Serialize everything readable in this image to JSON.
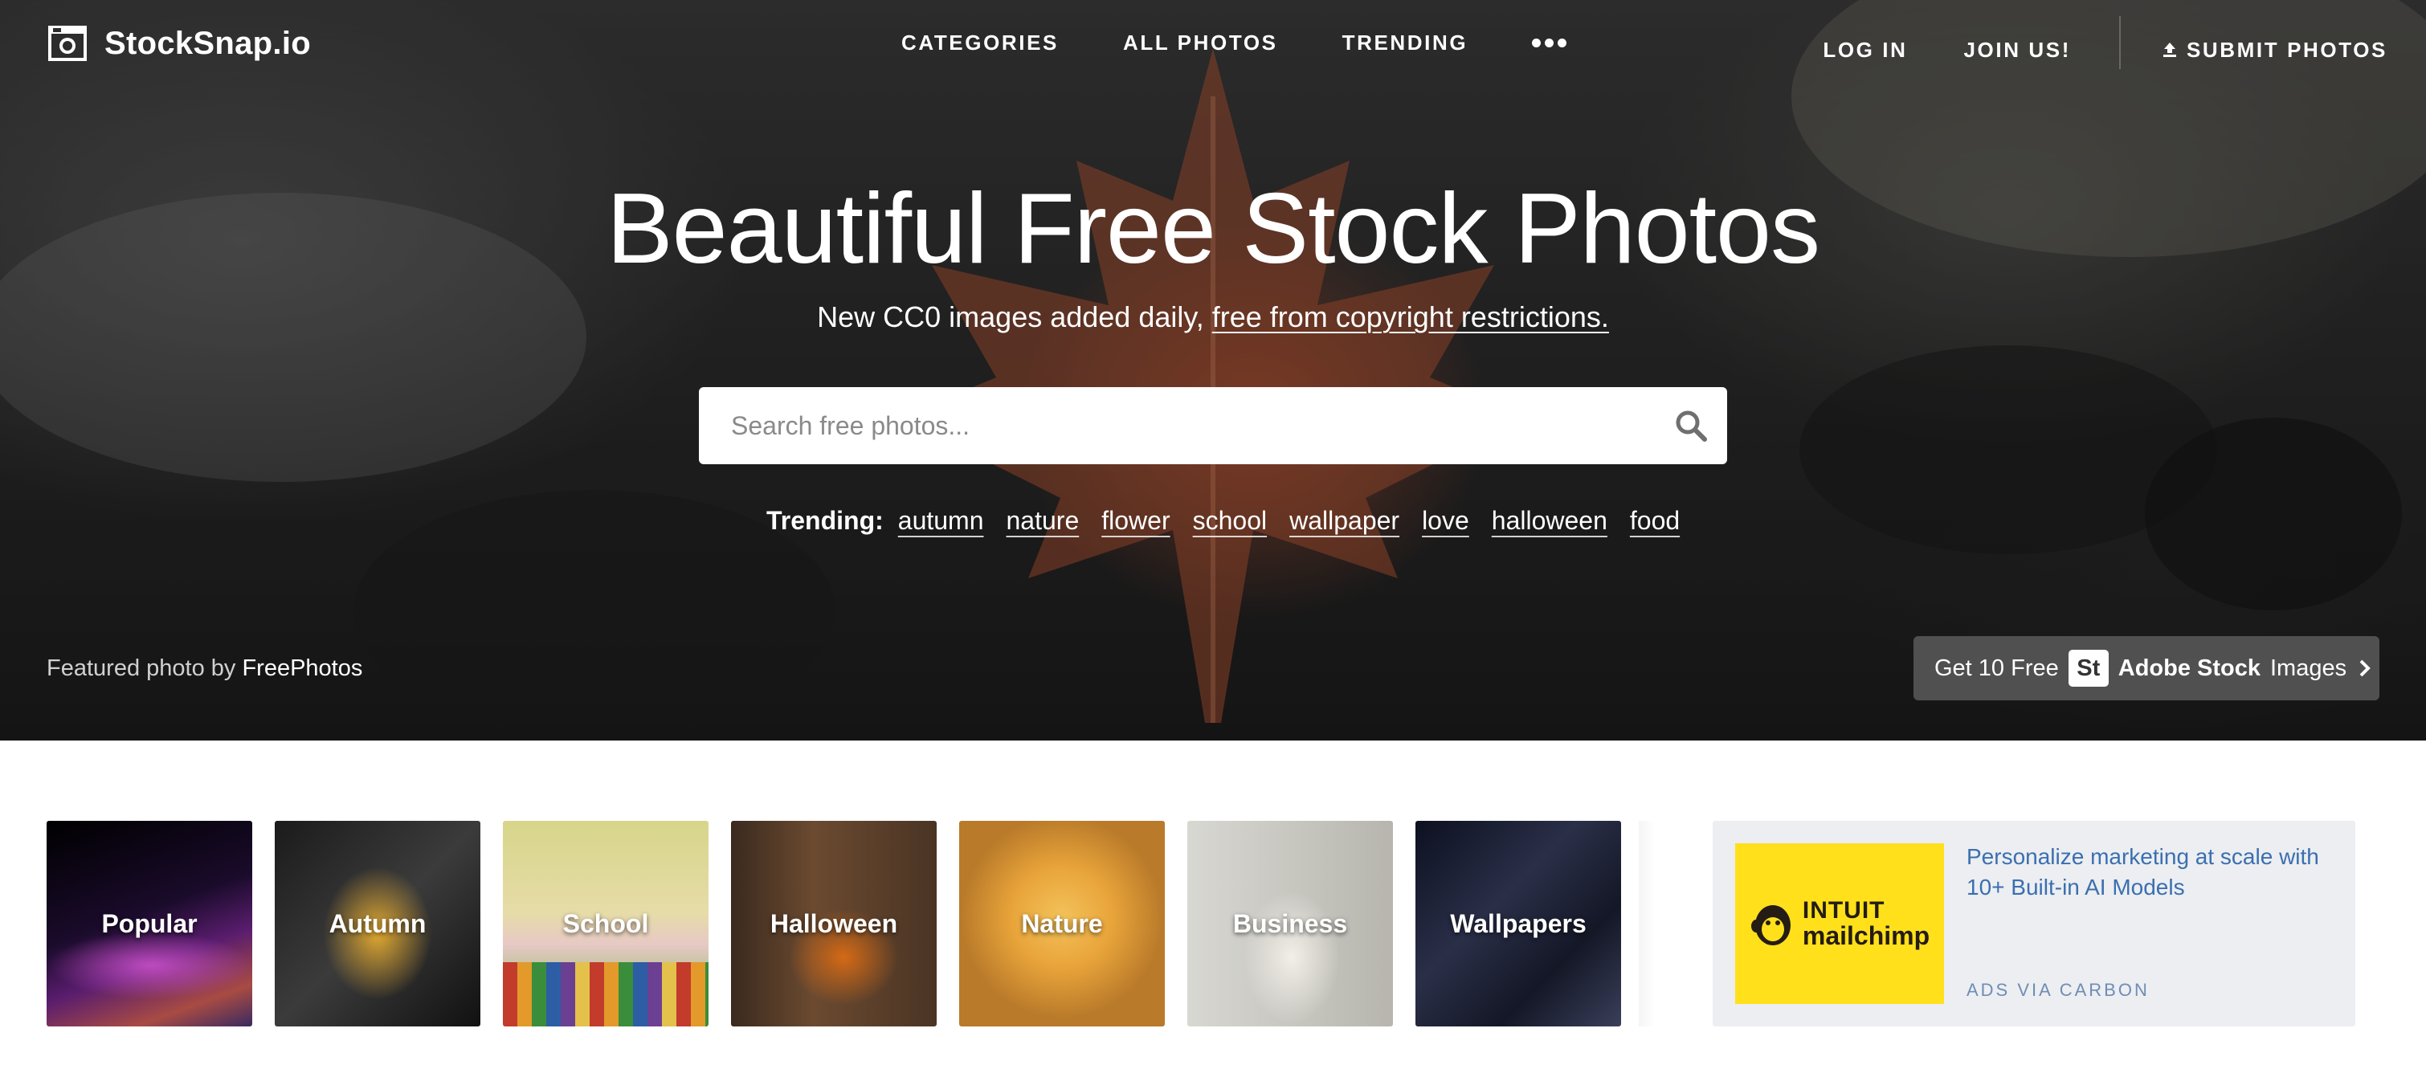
{
  "brand": {
    "name": "StockSnap.io",
    "icon": "camera-icon"
  },
  "nav": {
    "links": [
      "CATEGORIES",
      "ALL PHOTOS",
      "TRENDING"
    ],
    "more_icon": "more-dots-icon",
    "login": "LOG IN",
    "join": "JOIN US!",
    "submit": "SUBMIT PHOTOS",
    "submit_icon": "upload-icon"
  },
  "hero": {
    "title": "Beautiful Free Stock Photos",
    "subtitle_prefix": "New CC0 images added daily, ",
    "subtitle_link": "free from copyright restrictions.",
    "search": {
      "placeholder": "Search free photos...",
      "value": "",
      "icon": "search-icon"
    },
    "trending_label": "Trending:",
    "trending_tags": [
      "autumn",
      "nature",
      "flower",
      "school",
      "wallpaper",
      "love",
      "halloween",
      "food"
    ],
    "featured_prefix": "Featured photo by ",
    "featured_author": "FreePhotos",
    "adobe": {
      "prefix": "Get 10 Free",
      "badge": "St",
      "brand": "Adobe Stock",
      "suffix": "Images",
      "icon": "chevron-right-icon"
    }
  },
  "categories": [
    "Popular",
    "Autumn",
    "School",
    "Halloween",
    "Nature",
    "Business",
    "Wallpapers"
  ],
  "ad": {
    "logo_line1": "INTUIT",
    "logo_line2": "mailchimp",
    "text": "Personalize marketing at scale with 10+ Built-in AI Models",
    "via": "ADS VIA CARBON"
  },
  "colors": {
    "ad_link": "#3b6fb0",
    "ad_bg": "#eceef1",
    "mailchimp_yellow": "#ffe01b"
  }
}
